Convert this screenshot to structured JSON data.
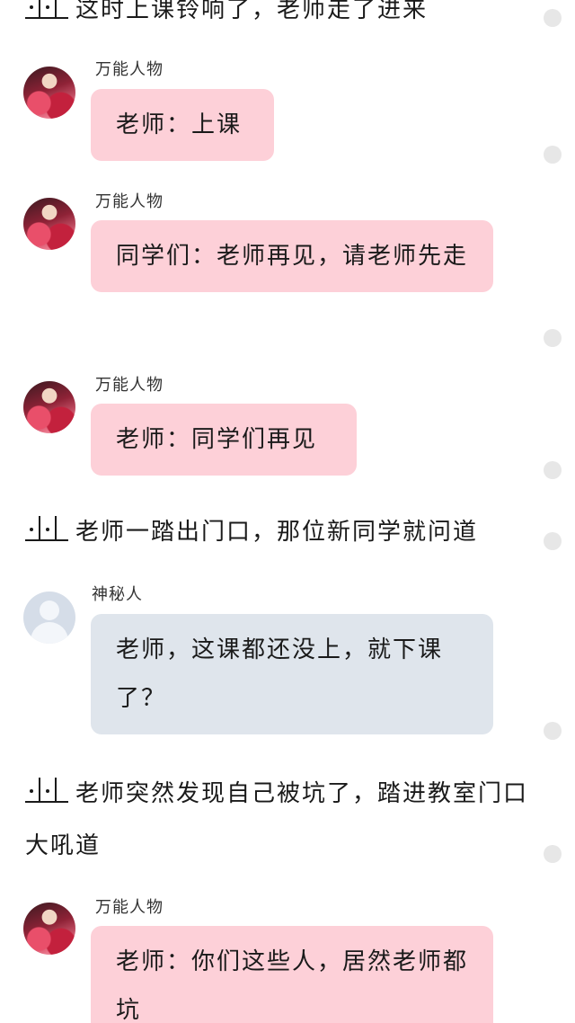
{
  "narrations": [
    {
      "text": "这时上课铃响了，老师走了进来"
    },
    {
      "text": "老师一踏出门口，那位新同学就问道"
    },
    {
      "text": "老师突然发现自己被坑了，踏进教室门口大吼道"
    }
  ],
  "messages": [
    {
      "sender": "万能人物",
      "text": "老师：上课"
    },
    {
      "sender": "万能人物",
      "text": "同学们：老师再见，请老师先走"
    },
    {
      "sender": "万能人物",
      "text": "老师：同学们再见"
    },
    {
      "sender": "神秘人",
      "text": "老师，这课都还没上，就下课了？"
    },
    {
      "sender": "万能人物",
      "text": "老师：你们这些人，居然老师都坑"
    }
  ],
  "icons": {
    "narration_marker": "double-bar-marker-icon",
    "character_avatar": "character-avatar-icon",
    "default_avatar": "default-user-avatar-icon",
    "side_indicator": "circle-dot-icon"
  },
  "colors": {
    "bubble_pink": "#fdd0d8",
    "bubble_blue": "#dfe5ec",
    "text": "#1a1a1a",
    "indicator": "#e7e7e7"
  }
}
